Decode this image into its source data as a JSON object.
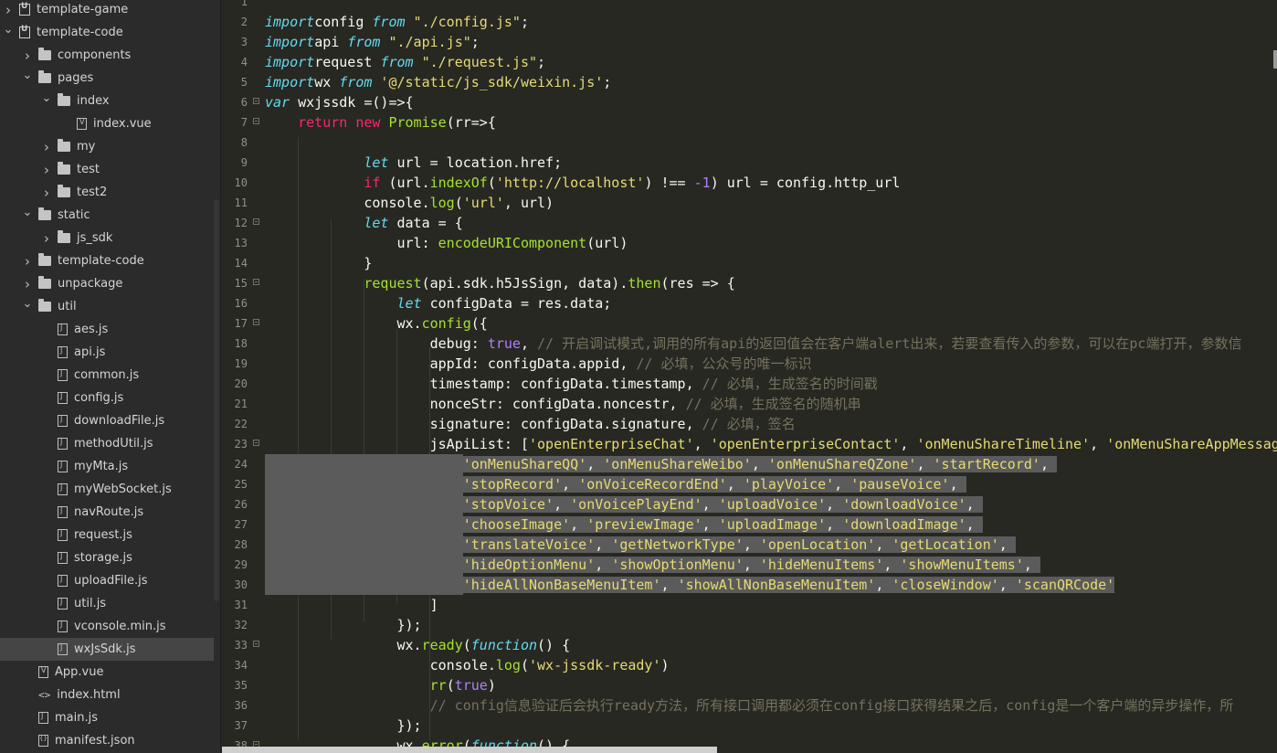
{
  "sidebar": {
    "items": [
      {
        "label": "template-game",
        "depth": 0,
        "type": "project",
        "expanded": false
      },
      {
        "label": "template-code",
        "depth": 0,
        "type": "project",
        "expanded": true
      },
      {
        "label": "components",
        "depth": 1,
        "type": "folder",
        "expanded": false
      },
      {
        "label": "pages",
        "depth": 1,
        "type": "folder",
        "expanded": true
      },
      {
        "label": "index",
        "depth": 2,
        "type": "folder",
        "expanded": true
      },
      {
        "label": "index.vue",
        "depth": 3,
        "type": "vue"
      },
      {
        "label": "my",
        "depth": 2,
        "type": "folder",
        "expanded": false
      },
      {
        "label": "test",
        "depth": 2,
        "type": "folder",
        "expanded": false
      },
      {
        "label": "test2",
        "depth": 2,
        "type": "folder",
        "expanded": false
      },
      {
        "label": "static",
        "depth": 1,
        "type": "folder",
        "expanded": true
      },
      {
        "label": "js_sdk",
        "depth": 2,
        "type": "folder",
        "expanded": false
      },
      {
        "label": "template-code",
        "depth": 1,
        "type": "folder",
        "expanded": false
      },
      {
        "label": "unpackage",
        "depth": 1,
        "type": "folder",
        "expanded": false
      },
      {
        "label": "util",
        "depth": 1,
        "type": "folder",
        "expanded": true
      },
      {
        "label": "aes.js",
        "depth": 2,
        "type": "js"
      },
      {
        "label": "api.js",
        "depth": 2,
        "type": "js"
      },
      {
        "label": "common.js",
        "depth": 2,
        "type": "js"
      },
      {
        "label": "config.js",
        "depth": 2,
        "type": "js"
      },
      {
        "label": "downloadFile.js",
        "depth": 2,
        "type": "js"
      },
      {
        "label": "methodUtil.js",
        "depth": 2,
        "type": "js"
      },
      {
        "label": "myMta.js",
        "depth": 2,
        "type": "js"
      },
      {
        "label": "myWebSocket.js",
        "depth": 2,
        "type": "js"
      },
      {
        "label": "navRoute.js",
        "depth": 2,
        "type": "js"
      },
      {
        "label": "request.js",
        "depth": 2,
        "type": "js"
      },
      {
        "label": "storage.js",
        "depth": 2,
        "type": "js"
      },
      {
        "label": "uploadFile.js",
        "depth": 2,
        "type": "js"
      },
      {
        "label": "util.js",
        "depth": 2,
        "type": "js"
      },
      {
        "label": "vconsole.min.js",
        "depth": 2,
        "type": "js"
      },
      {
        "label": "wxJsSdk.js",
        "depth": 2,
        "type": "js",
        "selected": true
      },
      {
        "label": "App.vue",
        "depth": 1,
        "type": "vue"
      },
      {
        "label": "index.html",
        "depth": 1,
        "type": "html"
      },
      {
        "label": "main.js",
        "depth": 1,
        "type": "js"
      },
      {
        "label": "manifest.json",
        "depth": 1,
        "type": "json"
      }
    ]
  },
  "editor": {
    "lines": [
      {
        "n": "1",
        "tokens": []
      },
      {
        "n": "2",
        "tokens": [
          [
            "kwi",
            "import"
          ],
          [
            "",
            "config "
          ],
          [
            "kwi",
            "from"
          ],
          [
            "",
            ""
          ],
          [
            "str",
            " \"./config.js\""
          ],
          [
            "",
            ";"
          ]
        ]
      },
      {
        "n": "3",
        "tokens": [
          [
            "kwi",
            "import"
          ],
          [
            "",
            "api "
          ],
          [
            "kwi",
            "from"
          ],
          [
            "str",
            " \"./api.js\""
          ],
          [
            "",
            ";"
          ]
        ]
      },
      {
        "n": "4",
        "tokens": [
          [
            "kwi",
            "import"
          ],
          [
            "",
            "request "
          ],
          [
            "kwi",
            "from"
          ],
          [
            "str",
            " \"./request.js\""
          ],
          [
            "",
            ";"
          ]
        ]
      },
      {
        "n": "5",
        "tokens": [
          [
            "kwi",
            "import"
          ],
          [
            "",
            "wx "
          ],
          [
            "kwi",
            "from"
          ],
          [
            "str",
            " '@/static/js_sdk/weixin.js'"
          ],
          [
            "",
            ";"
          ]
        ]
      },
      {
        "n": "6",
        "fold": true,
        "tokens": [
          [
            "kwi",
            "var"
          ],
          [
            "",
            " wxjssdk =()=>{"
          ]
        ]
      },
      {
        "n": "7",
        "fold": true,
        "tokens": [
          [
            "",
            "    "
          ],
          [
            "kw",
            "return"
          ],
          [
            "",
            " "
          ],
          [
            "kw",
            "new"
          ],
          [
            "",
            " "
          ],
          [
            "fn",
            "Promise"
          ],
          [
            "",
            "(rr=>{"
          ]
        ]
      },
      {
        "n": "8",
        "tokens": []
      },
      {
        "n": "9",
        "tokens": [
          [
            "",
            "            "
          ],
          [
            "kwi",
            "let"
          ],
          [
            "",
            " url = location.href;"
          ]
        ]
      },
      {
        "n": "10",
        "tokens": [
          [
            "",
            "            "
          ],
          [
            "kw",
            "if"
          ],
          [
            "",
            " (url."
          ],
          [
            "fn",
            "indexOf"
          ],
          [
            "",
            "("
          ],
          [
            "str",
            "'http://localhost'"
          ],
          [
            "",
            ") !== "
          ],
          [
            "num",
            "-1"
          ],
          [
            "",
            ") url = config.http_url"
          ]
        ]
      },
      {
        "n": "11",
        "tokens": [
          [
            "",
            "            console."
          ],
          [
            "fn",
            "log"
          ],
          [
            "",
            "("
          ],
          [
            "str",
            "'url'"
          ],
          [
            "",
            ", url)"
          ]
        ]
      },
      {
        "n": "12",
        "fold": true,
        "tokens": [
          [
            "",
            "            "
          ],
          [
            "kwi",
            "let"
          ],
          [
            "",
            " data = {"
          ]
        ]
      },
      {
        "n": "13",
        "tokens": [
          [
            "",
            "                url: "
          ],
          [
            "fn",
            "encodeURIComponent"
          ],
          [
            "",
            "(url)"
          ]
        ]
      },
      {
        "n": "14",
        "tokens": [
          [
            "",
            "            }"
          ]
        ]
      },
      {
        "n": "15",
        "fold": true,
        "tokens": [
          [
            "",
            "            "
          ],
          [
            "fn",
            "request"
          ],
          [
            "",
            "(api.sdk.h5JsSign, data)."
          ],
          [
            "fn",
            "then"
          ],
          [
            "",
            "(res => {"
          ]
        ]
      },
      {
        "n": "16",
        "tokens": [
          [
            "",
            "                "
          ],
          [
            "kwi",
            "let"
          ],
          [
            "",
            " configData = res.data;"
          ]
        ]
      },
      {
        "n": "17",
        "fold": true,
        "tokens": [
          [
            "",
            "                wx."
          ],
          [
            "fn",
            "config"
          ],
          [
            "",
            "({"
          ]
        ]
      },
      {
        "n": "18",
        "tokens": [
          [
            "",
            "                    debug: "
          ],
          [
            "num",
            "true"
          ],
          [
            "",
            ", "
          ],
          [
            "cm",
            "// 开启调试模式,调用的所有api的返回值会在客户端alert出来，若要查看传入的参数，可以在pc端打开，参数信"
          ]
        ]
      },
      {
        "n": "19",
        "tokens": [
          [
            "",
            "                    appId: configData.appid, "
          ],
          [
            "cm",
            "// 必填，公众号的唯一标识"
          ]
        ]
      },
      {
        "n": "20",
        "tokens": [
          [
            "",
            "                    timestamp: configData.timestamp, "
          ],
          [
            "cm",
            "// 必填，生成签名的时间戳"
          ]
        ]
      },
      {
        "n": "21",
        "tokens": [
          [
            "",
            "                    nonceStr: configData.noncestr, "
          ],
          [
            "cm",
            "// 必填，生成签名的随机串"
          ]
        ]
      },
      {
        "n": "22",
        "tokens": [
          [
            "",
            "                    signature: configData.signature, "
          ],
          [
            "cm",
            "// 必填，签名"
          ]
        ]
      },
      {
        "n": "23",
        "fold": true,
        "tokens": [
          [
            "",
            "                    jsApiList: ["
          ],
          [
            "str",
            "'openEnterpriseChat'"
          ],
          [
            "",
            ", "
          ],
          [
            "str",
            "'openEnterpriseContact'"
          ],
          [
            "",
            ", "
          ],
          [
            "str",
            "'onMenuShareTimeline'"
          ],
          [
            "",
            ", "
          ],
          [
            "str",
            "'onMenuShareAppMessag"
          ]
        ]
      },
      {
        "n": "24",
        "sel": true,
        "tokens": [
          [
            "",
            "                        "
          ],
          [
            "str",
            "'onMenuShareQQ'"
          ],
          [
            "",
            ", "
          ],
          [
            "str",
            "'onMenuShareWeibo'"
          ],
          [
            "",
            ", "
          ],
          [
            "str",
            "'onMenuShareQZone'"
          ],
          [
            "",
            ", "
          ],
          [
            "str",
            "'startRecord'"
          ],
          [
            "",
            ", "
          ]
        ]
      },
      {
        "n": "25",
        "sel": true,
        "tokens": [
          [
            "",
            "                        "
          ],
          [
            "str",
            "'stopRecord'"
          ],
          [
            "",
            ", "
          ],
          [
            "str",
            "'onVoiceRecordEnd'"
          ],
          [
            "",
            ", "
          ],
          [
            "str",
            "'playVoice'"
          ],
          [
            "",
            ", "
          ],
          [
            "str",
            "'pauseVoice'"
          ],
          [
            "",
            ", "
          ]
        ]
      },
      {
        "n": "26",
        "sel": true,
        "tokens": [
          [
            "",
            "                        "
          ],
          [
            "str",
            "'stopVoice'"
          ],
          [
            "",
            ", "
          ],
          [
            "str",
            "'onVoicePlayEnd'"
          ],
          [
            "",
            ", "
          ],
          [
            "str",
            "'uploadVoice'"
          ],
          [
            "",
            ", "
          ],
          [
            "str",
            "'downloadVoice'"
          ],
          [
            "",
            ", "
          ]
        ]
      },
      {
        "n": "27",
        "sel": true,
        "tokens": [
          [
            "",
            "                        "
          ],
          [
            "str",
            "'chooseImage'"
          ],
          [
            "",
            ", "
          ],
          [
            "str",
            "'previewImage'"
          ],
          [
            "",
            ", "
          ],
          [
            "str",
            "'uploadImage'"
          ],
          [
            "",
            ", "
          ],
          [
            "str",
            "'downloadImage'"
          ],
          [
            "",
            ", "
          ]
        ]
      },
      {
        "n": "28",
        "sel": true,
        "tokens": [
          [
            "",
            "                        "
          ],
          [
            "str",
            "'translateVoice'"
          ],
          [
            "",
            ", "
          ],
          [
            "str",
            "'getNetworkType'"
          ],
          [
            "",
            ", "
          ],
          [
            "str",
            "'openLocation'"
          ],
          [
            "",
            ", "
          ],
          [
            "str",
            "'getLocation'"
          ],
          [
            "",
            ", "
          ]
        ]
      },
      {
        "n": "29",
        "sel": true,
        "tokens": [
          [
            "",
            "                        "
          ],
          [
            "str",
            "'hideOptionMenu'"
          ],
          [
            "",
            ", "
          ],
          [
            "str",
            "'showOptionMenu'"
          ],
          [
            "",
            ", "
          ],
          [
            "str",
            "'hideMenuItems'"
          ],
          [
            "",
            ", "
          ],
          [
            "str",
            "'showMenuItems'"
          ],
          [
            "",
            ", "
          ]
        ]
      },
      {
        "n": "30",
        "sel": true,
        "tokens": [
          [
            "",
            "                        "
          ],
          [
            "str",
            "'hideAllNonBaseMenuItem'"
          ],
          [
            "",
            ", "
          ],
          [
            "str",
            "'showAllNonBaseMenuItem'"
          ],
          [
            "",
            ", "
          ],
          [
            "str",
            "'closeWindow'"
          ],
          [
            "",
            ", "
          ],
          [
            "str",
            "'scanQRCode'"
          ]
        ]
      },
      {
        "n": "31",
        "tokens": [
          [
            "",
            "                    ]"
          ]
        ]
      },
      {
        "n": "32",
        "tokens": [
          [
            "",
            "                });"
          ]
        ]
      },
      {
        "n": "33",
        "fold": true,
        "tokens": [
          [
            "",
            "                wx."
          ],
          [
            "fn",
            "ready"
          ],
          [
            "",
            "("
          ],
          [
            "kwi",
            "function"
          ],
          [
            "",
            "() {"
          ]
        ]
      },
      {
        "n": "34",
        "tokens": [
          [
            "",
            "                    console."
          ],
          [
            "fn",
            "log"
          ],
          [
            "",
            "("
          ],
          [
            "str",
            "'wx-jssdk-ready'"
          ],
          [
            "",
            ")"
          ]
        ]
      },
      {
        "n": "35",
        "tokens": [
          [
            "",
            "                    "
          ],
          [
            "fn",
            "rr"
          ],
          [
            "",
            "("
          ],
          [
            "num",
            "true"
          ],
          [
            "",
            ")"
          ]
        ]
      },
      {
        "n": "36",
        "tokens": [
          [
            "",
            "                    "
          ],
          [
            "cm",
            "// config信息验证后会执行ready方法，所有接口调用都必须在config接口获得结果之后，config是一个客户端的异步操作，所"
          ]
        ]
      },
      {
        "n": "37",
        "tokens": [
          [
            "",
            "                });"
          ]
        ]
      },
      {
        "n": "38",
        "fold": true,
        "tokens": [
          [
            "",
            "                wx."
          ],
          [
            "fn",
            "error"
          ],
          [
            "",
            "("
          ],
          [
            "kwi",
            "function"
          ],
          [
            "",
            "() {"
          ]
        ]
      }
    ]
  }
}
